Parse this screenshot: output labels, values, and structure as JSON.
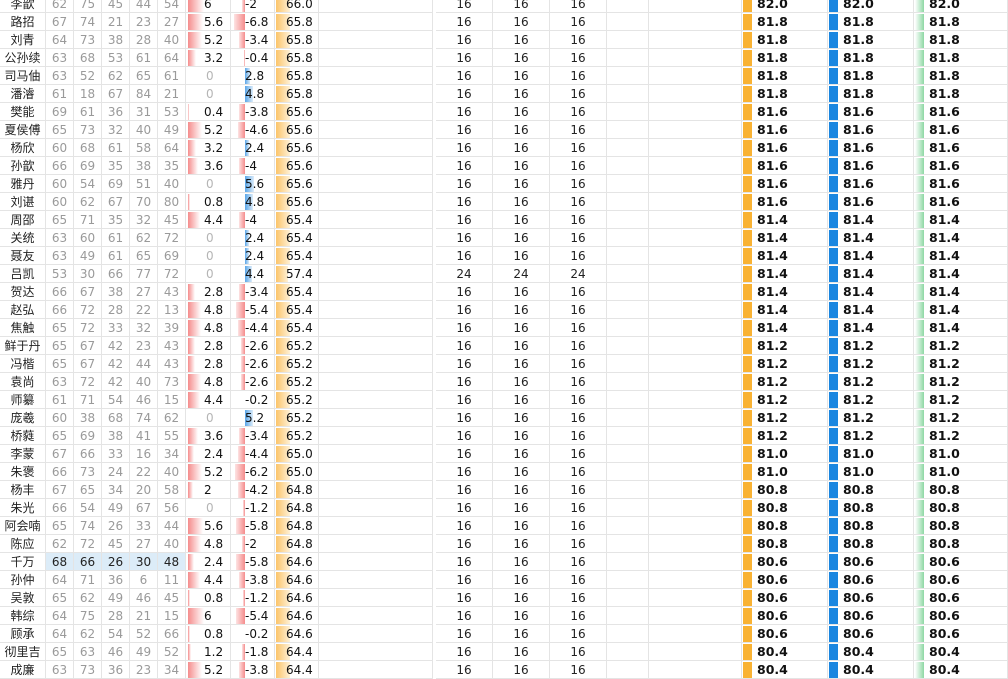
{
  "columns": {
    "stat_count": 5,
    "stat_cell_lefts": [
      46,
      74,
      102,
      130,
      158
    ]
  },
  "colors": {
    "red_bar": "#f58c8c",
    "blue_bar": "#5aa6e8",
    "orange_bar": "#fbc46a",
    "gold_bar": "#f9b233",
    "blue_solid": "#1a86e0",
    "green_bar": "#8ed8a4",
    "highlight": "#dcecf8"
  },
  "scale": {
    "a_max": 6.8,
    "b_max": 6.8,
    "c_max": 70
  },
  "rows": [
    {
      "name": "李歆",
      "stats": [
        "62",
        "75",
        "45",
        "44",
        "54"
      ],
      "a": "6",
      "a_val": 6,
      "b": "-2",
      "b_val": -2,
      "c": "66.0",
      "c_val": 66.0,
      "n": [
        "16",
        "16",
        "16"
      ],
      "v": "82.0"
    },
    {
      "name": "路招",
      "stats": [
        "67",
        "74",
        "21",
        "23",
        "27"
      ],
      "a": "5.6",
      "a_val": 5.6,
      "b": "-6.8",
      "b_val": -6.8,
      "c": "65.8",
      "c_val": 65.8,
      "n": [
        "16",
        "16",
        "16"
      ],
      "v": "81.8"
    },
    {
      "name": "刘青",
      "stats": [
        "64",
        "73",
        "38",
        "28",
        "40"
      ],
      "a": "5.2",
      "a_val": 5.2,
      "b": "-3.4",
      "b_val": -3.4,
      "c": "65.8",
      "c_val": 65.8,
      "n": [
        "16",
        "16",
        "16"
      ],
      "v": "81.8"
    },
    {
      "name": "公孙续",
      "stats": [
        "63",
        "68",
        "53",
        "61",
        "64"
      ],
      "a": "3.2",
      "a_val": 3.2,
      "b": "-0.4",
      "b_val": -0.4,
      "c": "65.8",
      "c_val": 65.8,
      "n": [
        "16",
        "16",
        "16"
      ],
      "v": "81.8"
    },
    {
      "name": "司马伷",
      "stats": [
        "63",
        "52",
        "62",
        "65",
        "61"
      ],
      "a": "0",
      "a_val": 0,
      "b": "2.8",
      "b_val": 2.8,
      "c": "65.8",
      "c_val": 65.8,
      "n": [
        "16",
        "16",
        "16"
      ],
      "v": "81.8"
    },
    {
      "name": "潘濬",
      "stats": [
        "61",
        "18",
        "67",
        "84",
        "21"
      ],
      "a": "0",
      "a_val": 0,
      "b": "4.8",
      "b_val": 4.8,
      "c": "65.8",
      "c_val": 65.8,
      "n": [
        "16",
        "16",
        "16"
      ],
      "v": "81.8"
    },
    {
      "name": "樊能",
      "stats": [
        "69",
        "61",
        "36",
        "31",
        "53"
      ],
      "a": "0.4",
      "a_val": 0.4,
      "b": "-3.8",
      "b_val": -3.8,
      "c": "65.6",
      "c_val": 65.6,
      "n": [
        "16",
        "16",
        "16"
      ],
      "v": "81.6"
    },
    {
      "name": "夏侯傅",
      "stats": [
        "65",
        "73",
        "32",
        "40",
        "49"
      ],
      "a": "5.2",
      "a_val": 5.2,
      "b": "-4.6",
      "b_val": -4.6,
      "c": "65.6",
      "c_val": 65.6,
      "n": [
        "16",
        "16",
        "16"
      ],
      "v": "81.6"
    },
    {
      "name": "杨欣",
      "stats": [
        "60",
        "68",
        "61",
        "58",
        "64"
      ],
      "a": "3.2",
      "a_val": 3.2,
      "b": "2.4",
      "b_val": 2.4,
      "c": "65.6",
      "c_val": 65.6,
      "n": [
        "16",
        "16",
        "16"
      ],
      "v": "81.6"
    },
    {
      "name": "孙歆",
      "stats": [
        "66",
        "69",
        "35",
        "38",
        "35"
      ],
      "a": "3.6",
      "a_val": 3.6,
      "b": "-4",
      "b_val": -4,
      "c": "65.6",
      "c_val": 65.6,
      "n": [
        "16",
        "16",
        "16"
      ],
      "v": "81.6"
    },
    {
      "name": "雅丹",
      "stats": [
        "60",
        "54",
        "69",
        "51",
        "40"
      ],
      "a": "0",
      "a_val": 0,
      "b": "5.6",
      "b_val": 5.6,
      "c": "65.6",
      "c_val": 65.6,
      "n": [
        "16",
        "16",
        "16"
      ],
      "v": "81.6"
    },
    {
      "name": "刘谌",
      "stats": [
        "60",
        "62",
        "67",
        "70",
        "80"
      ],
      "a": "0.8",
      "a_val": 0.8,
      "b": "4.8",
      "b_val": 4.8,
      "c": "65.6",
      "c_val": 65.6,
      "n": [
        "16",
        "16",
        "16"
      ],
      "v": "81.6"
    },
    {
      "name": "周邵",
      "stats": [
        "65",
        "71",
        "35",
        "32",
        "45"
      ],
      "a": "4.4",
      "a_val": 4.4,
      "b": "-4",
      "b_val": -4,
      "c": "65.4",
      "c_val": 65.4,
      "n": [
        "16",
        "16",
        "16"
      ],
      "v": "81.4"
    },
    {
      "name": "关统",
      "stats": [
        "63",
        "60",
        "61",
        "62",
        "72"
      ],
      "a": "0",
      "a_val": 0,
      "b": "2.4",
      "b_val": 2.4,
      "c": "65.4",
      "c_val": 65.4,
      "n": [
        "16",
        "16",
        "16"
      ],
      "v": "81.4"
    },
    {
      "name": "聂友",
      "stats": [
        "63",
        "49",
        "61",
        "65",
        "69"
      ],
      "a": "0",
      "a_val": 0,
      "b": "2.4",
      "b_val": 2.4,
      "c": "65.4",
      "c_val": 65.4,
      "n": [
        "16",
        "16",
        "16"
      ],
      "v": "81.4"
    },
    {
      "name": "吕凯",
      "stats": [
        "53",
        "30",
        "66",
        "77",
        "72"
      ],
      "a": "0",
      "a_val": 0,
      "b": "4.4",
      "b_val": 4.4,
      "c": "57.4",
      "c_val": 57.4,
      "n": [
        "24",
        "24",
        "24"
      ],
      "v": "81.4"
    },
    {
      "name": "贺达",
      "stats": [
        "66",
        "67",
        "38",
        "27",
        "43"
      ],
      "a": "2.8",
      "a_val": 2.8,
      "b": "-3.4",
      "b_val": -3.4,
      "c": "65.4",
      "c_val": 65.4,
      "n": [
        "16",
        "16",
        "16"
      ],
      "v": "81.4"
    },
    {
      "name": "赵弘",
      "stats": [
        "66",
        "72",
        "28",
        "22",
        "13"
      ],
      "a": "4.8",
      "a_val": 4.8,
      "b": "-5.4",
      "b_val": -5.4,
      "c": "65.4",
      "c_val": 65.4,
      "n": [
        "16",
        "16",
        "16"
      ],
      "v": "81.4"
    },
    {
      "name": "焦触",
      "stats": [
        "65",
        "72",
        "33",
        "32",
        "39"
      ],
      "a": "4.8",
      "a_val": 4.8,
      "b": "-4.4",
      "b_val": -4.4,
      "c": "65.4",
      "c_val": 65.4,
      "n": [
        "16",
        "16",
        "16"
      ],
      "v": "81.4"
    },
    {
      "name": "鲜于丹",
      "stats": [
        "65",
        "67",
        "42",
        "23",
        "43"
      ],
      "a": "2.8",
      "a_val": 2.8,
      "b": "-2.6",
      "b_val": -2.6,
      "c": "65.2",
      "c_val": 65.2,
      "n": [
        "16",
        "16",
        "16"
      ],
      "v": "81.2"
    },
    {
      "name": "冯楷",
      "stats": [
        "65",
        "67",
        "42",
        "44",
        "43"
      ],
      "a": "2.8",
      "a_val": 2.8,
      "b": "-2.6",
      "b_val": -2.6,
      "c": "65.2",
      "c_val": 65.2,
      "n": [
        "16",
        "16",
        "16"
      ],
      "v": "81.2"
    },
    {
      "name": "袁尚",
      "stats": [
        "63",
        "72",
        "42",
        "40",
        "73"
      ],
      "a": "4.8",
      "a_val": 4.8,
      "b": "-2.6",
      "b_val": -2.6,
      "c": "65.2",
      "c_val": 65.2,
      "n": [
        "16",
        "16",
        "16"
      ],
      "v": "81.2"
    },
    {
      "name": "师纂",
      "stats": [
        "61",
        "71",
        "54",
        "46",
        "15"
      ],
      "a": "4.4",
      "a_val": 4.4,
      "b": "-0.2",
      "b_val": -0.2,
      "c": "65.2",
      "c_val": 65.2,
      "n": [
        "16",
        "16",
        "16"
      ],
      "v": "81.2"
    },
    {
      "name": "庞羲",
      "stats": [
        "60",
        "38",
        "68",
        "74",
        "62"
      ],
      "a": "0",
      "a_val": 0,
      "b": "5.2",
      "b_val": 5.2,
      "c": "65.2",
      "c_val": 65.2,
      "n": [
        "16",
        "16",
        "16"
      ],
      "v": "81.2"
    },
    {
      "name": "桥蕤",
      "stats": [
        "65",
        "69",
        "38",
        "41",
        "55"
      ],
      "a": "3.6",
      "a_val": 3.6,
      "b": "-3.4",
      "b_val": -3.4,
      "c": "65.2",
      "c_val": 65.2,
      "n": [
        "16",
        "16",
        "16"
      ],
      "v": "81.2"
    },
    {
      "name": "李蒙",
      "stats": [
        "67",
        "66",
        "33",
        "16",
        "34"
      ],
      "a": "2.4",
      "a_val": 2.4,
      "b": "-4.4",
      "b_val": -4.4,
      "c": "65.0",
      "c_val": 65.0,
      "n": [
        "16",
        "16",
        "16"
      ],
      "v": "81.0"
    },
    {
      "name": "朱褒",
      "stats": [
        "66",
        "73",
        "24",
        "22",
        "40"
      ],
      "a": "5.2",
      "a_val": 5.2,
      "b": "-6.2",
      "b_val": -6.2,
      "c": "65.0",
      "c_val": 65.0,
      "n": [
        "16",
        "16",
        "16"
      ],
      "v": "81.0"
    },
    {
      "name": "杨丰",
      "stats": [
        "67",
        "65",
        "34",
        "20",
        "58"
      ],
      "a": "2",
      "a_val": 2,
      "b": "-4.2",
      "b_val": -4.2,
      "c": "64.8",
      "c_val": 64.8,
      "n": [
        "16",
        "16",
        "16"
      ],
      "v": "80.8"
    },
    {
      "name": "朱光",
      "stats": [
        "66",
        "54",
        "49",
        "67",
        "56"
      ],
      "a": "0",
      "a_val": 0,
      "b": "-1.2",
      "b_val": -1.2,
      "c": "64.8",
      "c_val": 64.8,
      "n": [
        "16",
        "16",
        "16"
      ],
      "v": "80.8"
    },
    {
      "name": "阿会喃",
      "stats": [
        "65",
        "74",
        "26",
        "33",
        "44"
      ],
      "a": "5.6",
      "a_val": 5.6,
      "b": "-5.8",
      "b_val": -5.8,
      "c": "64.8",
      "c_val": 64.8,
      "n": [
        "16",
        "16",
        "16"
      ],
      "v": "80.8"
    },
    {
      "name": "陈应",
      "stats": [
        "62",
        "72",
        "45",
        "27",
        "40"
      ],
      "a": "4.8",
      "a_val": 4.8,
      "b": "-2",
      "b_val": -2,
      "c": "64.8",
      "c_val": 64.8,
      "n": [
        "16",
        "16",
        "16"
      ],
      "v": "80.8"
    },
    {
      "name": "千万",
      "stats": [
        "68",
        "66",
        "26",
        "30",
        "48"
      ],
      "a": "2.4",
      "a_val": 2.4,
      "b": "-5.8",
      "b_val": -5.8,
      "c": "64.6",
      "c_val": 64.6,
      "n": [
        "16",
        "16",
        "16"
      ],
      "v": "80.6",
      "highlight": true
    },
    {
      "name": "孙仲",
      "stats": [
        "64",
        "71",
        "36",
        "6",
        "11"
      ],
      "a": "4.4",
      "a_val": 4.4,
      "b": "-3.8",
      "b_val": -3.8,
      "c": "64.6",
      "c_val": 64.6,
      "n": [
        "16",
        "16",
        "16"
      ],
      "v": "80.6"
    },
    {
      "name": "吴敦",
      "stats": [
        "65",
        "62",
        "49",
        "46",
        "45"
      ],
      "a": "0.8",
      "a_val": 0.8,
      "b": "-1.2",
      "b_val": -1.2,
      "c": "64.6",
      "c_val": 64.6,
      "n": [
        "16",
        "16",
        "16"
      ],
      "v": "80.6"
    },
    {
      "name": "韩综",
      "stats": [
        "64",
        "75",
        "28",
        "21",
        "15"
      ],
      "a": "6",
      "a_val": 6,
      "b": "-5.4",
      "b_val": -5.4,
      "c": "64.6",
      "c_val": 64.6,
      "n": [
        "16",
        "16",
        "16"
      ],
      "v": "80.6"
    },
    {
      "name": "顾承",
      "stats": [
        "64",
        "62",
        "54",
        "52",
        "66"
      ],
      "a": "0.8",
      "a_val": 0.8,
      "b": "-0.2",
      "b_val": -0.2,
      "c": "64.6",
      "c_val": 64.6,
      "n": [
        "16",
        "16",
        "16"
      ],
      "v": "80.6"
    },
    {
      "name": "彻里吉",
      "stats": [
        "65",
        "63",
        "46",
        "49",
        "52"
      ],
      "a": "1.2",
      "a_val": 1.2,
      "b": "-1.8",
      "b_val": -1.8,
      "c": "64.4",
      "c_val": 64.4,
      "n": [
        "16",
        "16",
        "16"
      ],
      "v": "80.4"
    },
    {
      "name": "成廉",
      "stats": [
        "63",
        "73",
        "36",
        "23",
        "34"
      ],
      "a": "5.2",
      "a_val": 5.2,
      "b": "-3.8",
      "b_val": -3.8,
      "c": "64.4",
      "c_val": 64.4,
      "n": [
        "16",
        "16",
        "16"
      ],
      "v": "80.4"
    }
  ]
}
